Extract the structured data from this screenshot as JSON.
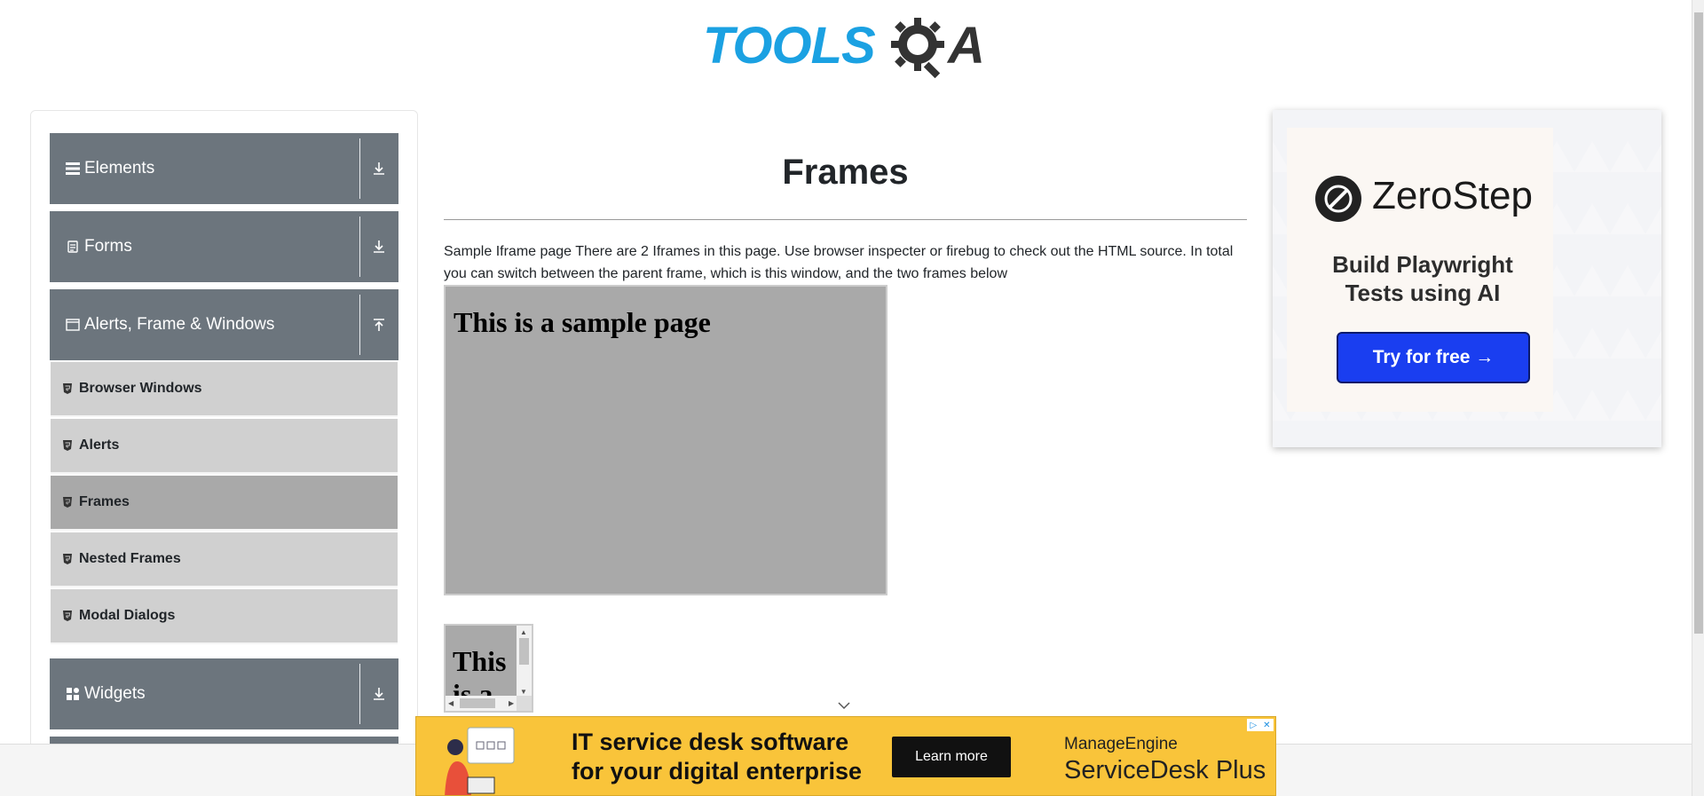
{
  "header": {
    "logo_text": "TOOLS",
    "logo_letter_a": "A"
  },
  "sidebar": {
    "groups": [
      {
        "label": "Elements",
        "icon": "menu-icon",
        "toggle": "download-arrow-icon"
      },
      {
        "label": "Forms",
        "icon": "document-icon",
        "toggle": "download-arrow-icon"
      },
      {
        "label": "Alerts, Frame & Windows",
        "icon": "window-icon",
        "toggle": "upload-arrow-icon"
      },
      {
        "label": "Widgets",
        "icon": "grid-icon",
        "toggle": "download-arrow-icon"
      }
    ],
    "submenu": [
      {
        "label": "Browser Windows"
      },
      {
        "label": "Alerts"
      },
      {
        "label": "Frames",
        "active": true
      },
      {
        "label": "Nested Frames"
      },
      {
        "label": "Modal Dialogs"
      }
    ]
  },
  "main": {
    "title": "Frames",
    "intro": "Sample Iframe page There are 2 Iframes in this page. Use browser inspecter or firebug to check out the HTML source. In total you can switch between the parent frame, which is this window, and the two frames below",
    "frame1_heading": "This is a sample page",
    "frame2_heading": "This is a sample page"
  },
  "ad_right": {
    "brand": "ZeroStep",
    "tagline": "Build Playwright Tests using AI",
    "cta": "Try for free →"
  },
  "banner": {
    "line1": "IT service desk software",
    "line2": "for your digital enterprise",
    "button": "Learn more",
    "brand_top": "ManageEngine",
    "brand_bottom": "ServiceDesk Plus"
  },
  "colors": {
    "sidebar_header": "#6c757d",
    "submenu_bg": "#d0d0d0",
    "submenu_active": "#a9a9a9",
    "frame_bg": "#a9a9a9",
    "logo_blue": "#1ba1e2",
    "banner_yellow": "#f9c43a",
    "cta_blue": "#1a3ef0"
  }
}
